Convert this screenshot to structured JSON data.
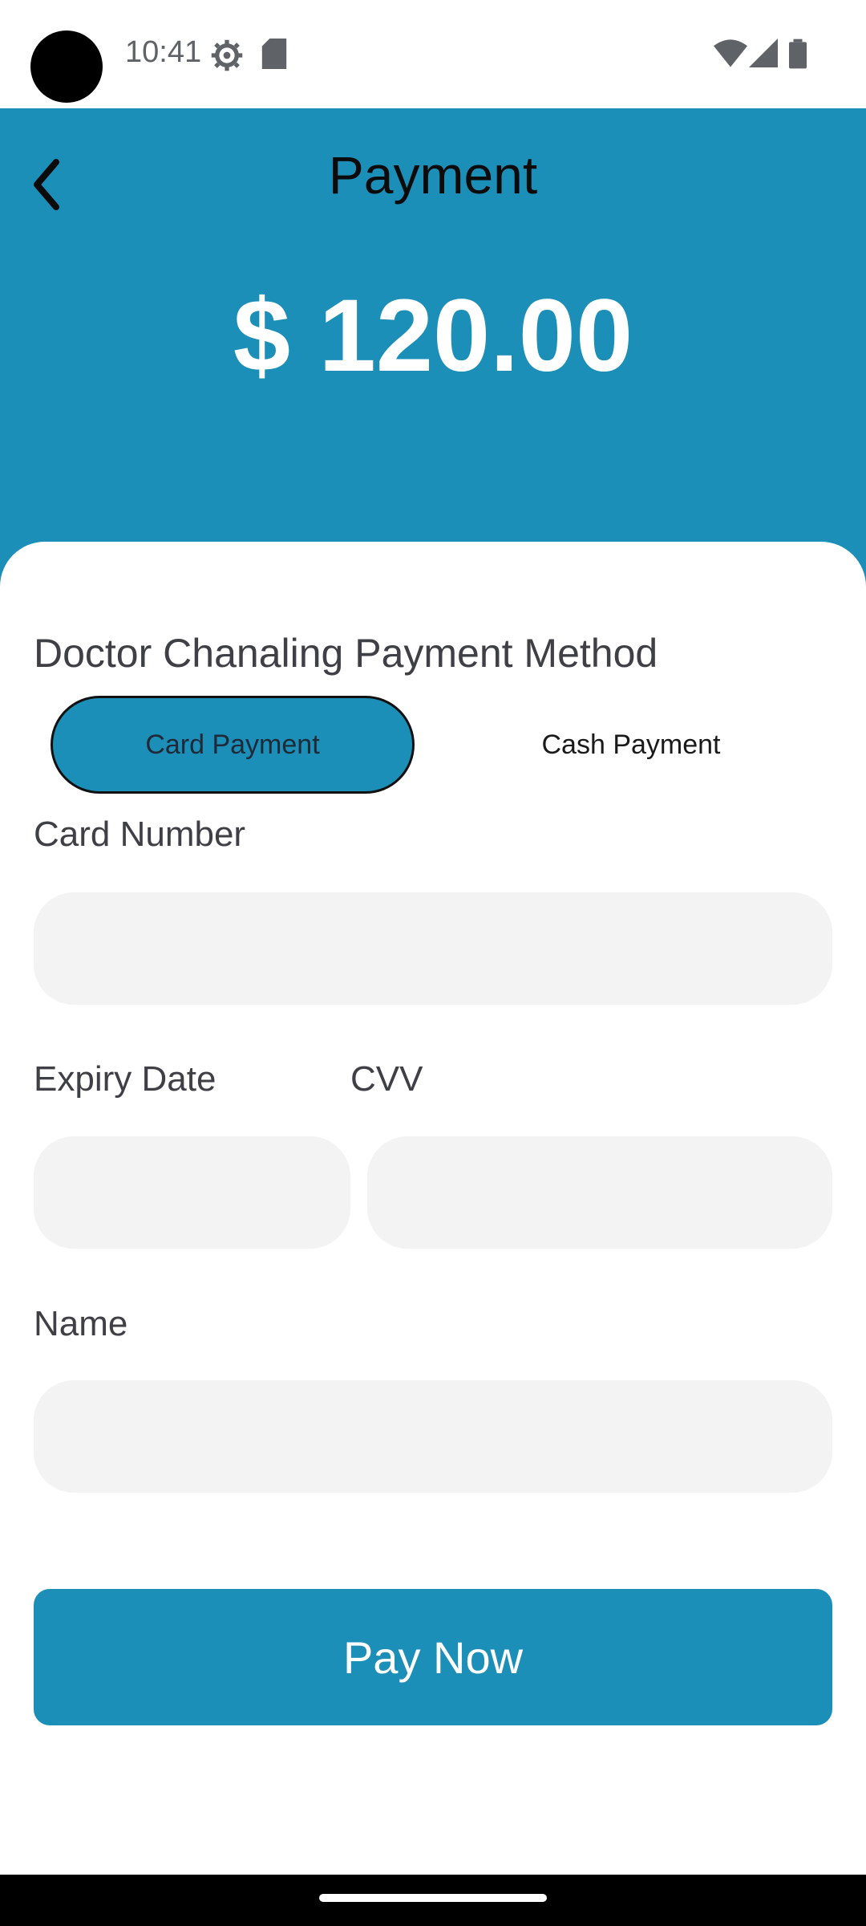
{
  "status_bar": {
    "time": "10:41",
    "icons": [
      "gear-icon",
      "sd-card-icon",
      "wifi-icon",
      "signal-icon",
      "battery-icon"
    ]
  },
  "header": {
    "title": "Payment",
    "amount": "$ 120.00",
    "back_icon": "chevron-left-icon"
  },
  "sheet": {
    "section_title": "Doctor Chanaling Payment Method",
    "toggle": {
      "card_label": "Card Payment",
      "cash_label": "Cash Payment",
      "selected": "Card Payment"
    },
    "fields": {
      "card_number_label": "Card Number",
      "card_number_value": "",
      "expiry_label": "Expiry Date",
      "expiry_value": "",
      "cvv_label": "CVV",
      "cvv_value": "",
      "name_label": "Name",
      "name_value": ""
    },
    "pay_button": "Pay Now"
  },
  "colors": {
    "accent": "#1b8fb8",
    "input_bg": "#f3f3f3",
    "label_text": "#3f3f46"
  }
}
